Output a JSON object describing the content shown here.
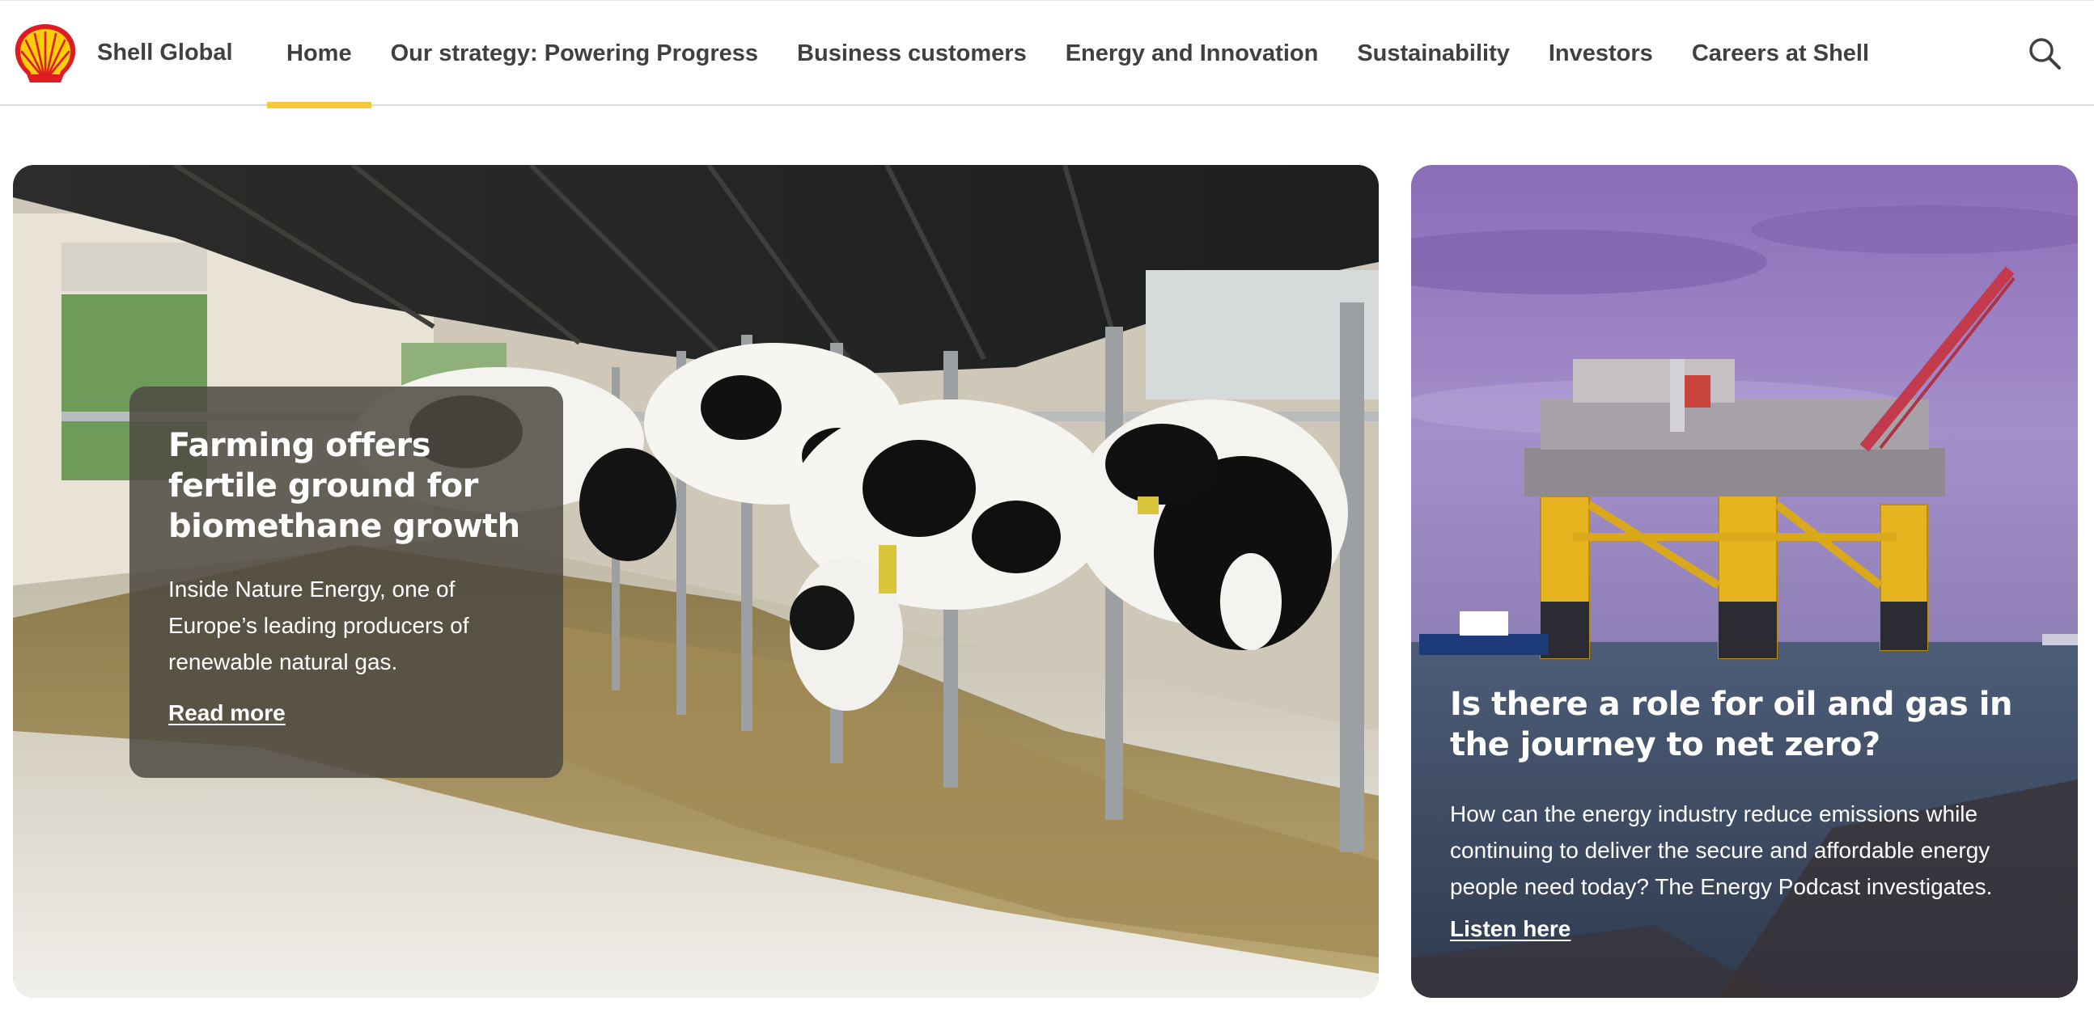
{
  "header": {
    "site_name": "Shell Global",
    "nav": [
      {
        "label": "Home",
        "active": true
      },
      {
        "label": "Our strategy: Powering Progress",
        "active": false
      },
      {
        "label": "Business customers",
        "active": false
      },
      {
        "label": "Energy and Innovation",
        "active": false
      },
      {
        "label": "Sustainability",
        "active": false
      },
      {
        "label": "Investors",
        "active": false
      },
      {
        "label": "Careers at Shell",
        "active": false
      }
    ],
    "search_icon": "search-icon",
    "logo_icon": "shell-pecten-logo"
  },
  "featured": {
    "title": "Farming offers fertile ground for biomethane growth",
    "description": "Inside Nature Energy, one of Europe’s leading producers of renewable natural gas.",
    "link": "Read more"
  },
  "secondary": {
    "title": "Is there a role for oil and gas in the journey to net zero?",
    "description": "How can the energy industry reduce emissions while continuing to deliver the secure and affordable energy people need today? The Energy Podcast investigates.",
    "link": "Listen here"
  },
  "colors": {
    "accent": "#f5c93c",
    "shell_red": "#dd1d21",
    "shell_yellow": "#fbce07",
    "nav_text": "#404040"
  }
}
